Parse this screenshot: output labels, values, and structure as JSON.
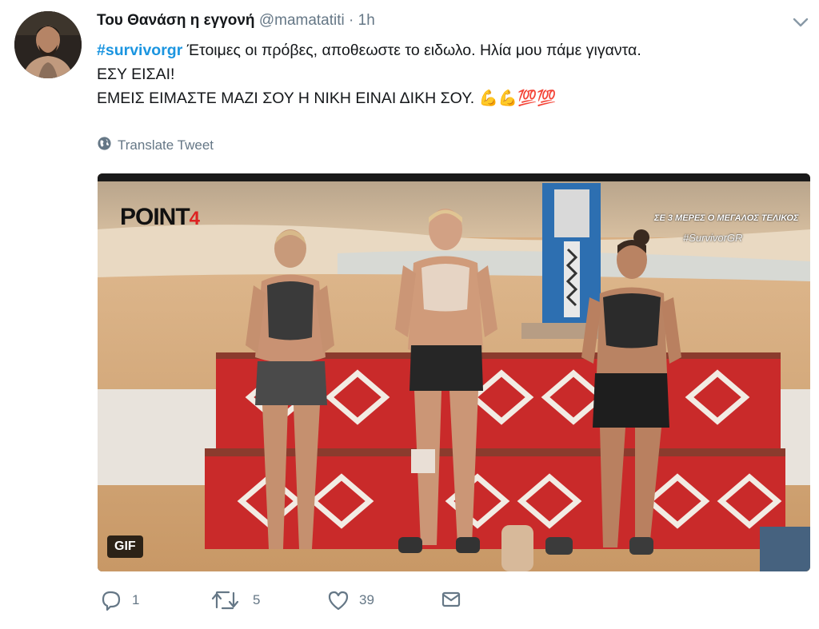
{
  "tweet": {
    "display_name": "Του Θανάση η εγγονή",
    "handle": "@mamatatiti",
    "separator": "·",
    "time": "1h",
    "hashtag": "#survivorgr",
    "line1_rest": " Έτοιμες οι πρόβες, αποθεωστε το ειδωλο. Ηλία μου πάμε γιγαντα.",
    "line2": "ΕΣΥ ΕΙΣΑΙ!",
    "line3": "ΕΜΕΙΣ ΕΙΜΑΣΤΕ ΜΑΖΙ ΣΟΥ Η ΝΙΚΗ ΕΙΝΑΙ ΔΙΚΗ ΣΟΥ. ",
    "emojis": "💪💪💯💯",
    "translate_label": "Translate Tweet"
  },
  "media": {
    "badge": "GIF",
    "logo_text": "POINT",
    "logo_suffix": "4",
    "overlay_title": "ΣΕ 3 ΜΕΡΕΣ Ο ΜΕΓΑΛΟΣ ΤΕΛΙΚΟΣ",
    "overlay_hashtag": "#SurvivorGR"
  },
  "actions": {
    "reply_count": "1",
    "retweet_count": "5",
    "like_count": "39"
  },
  "colors": {
    "hashtag": "#1b95e0",
    "meta": "#657786",
    "text": "#14171a",
    "podium_red": "#c92a2a"
  },
  "icons": {
    "more": "chevron-down-icon",
    "translate": "globe-icon",
    "reply": "reply-icon",
    "retweet": "retweet-icon",
    "like": "heart-icon",
    "dm": "envelope-icon"
  }
}
